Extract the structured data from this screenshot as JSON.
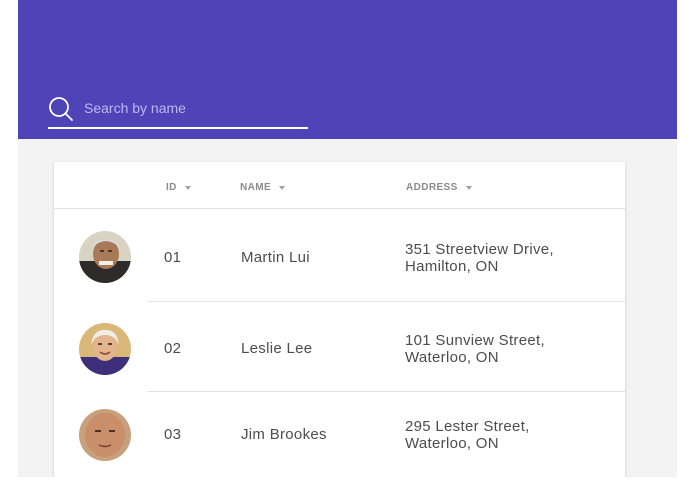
{
  "colors": {
    "header_bg": "#4e44b8",
    "page_bg": "#f3f3f3",
    "card_bg": "#ffffff",
    "text": "#4d4d4d",
    "header_text": "#8b8b8b"
  },
  "search": {
    "icon": "search-icon",
    "placeholder": "Search by name",
    "value": ""
  },
  "table": {
    "columns": [
      {
        "label": "ID",
        "sort_icon": "chevron-down-icon"
      },
      {
        "label": "NAME",
        "sort_icon": "chevron-down-icon"
      },
      {
        "label": "ADDRESS",
        "sort_icon": "chevron-down-icon"
      }
    ],
    "rows": [
      {
        "avatar": "avatar-photo",
        "id": "01",
        "name": "Martin Lui",
        "address_line1": "351 Streetview Drive,",
        "address_line2": "Hamilton, ON"
      },
      {
        "avatar": "avatar-photo",
        "id": "02",
        "name": "Leslie Lee",
        "address_line1": "101 Sunview Street,",
        "address_line2": "Waterloo, ON"
      },
      {
        "avatar": "avatar-photo",
        "id": "03",
        "name": "Jim Brookes",
        "address_line1": "295 Lester Street,",
        "address_line2": "Waterloo, ON"
      }
    ]
  }
}
